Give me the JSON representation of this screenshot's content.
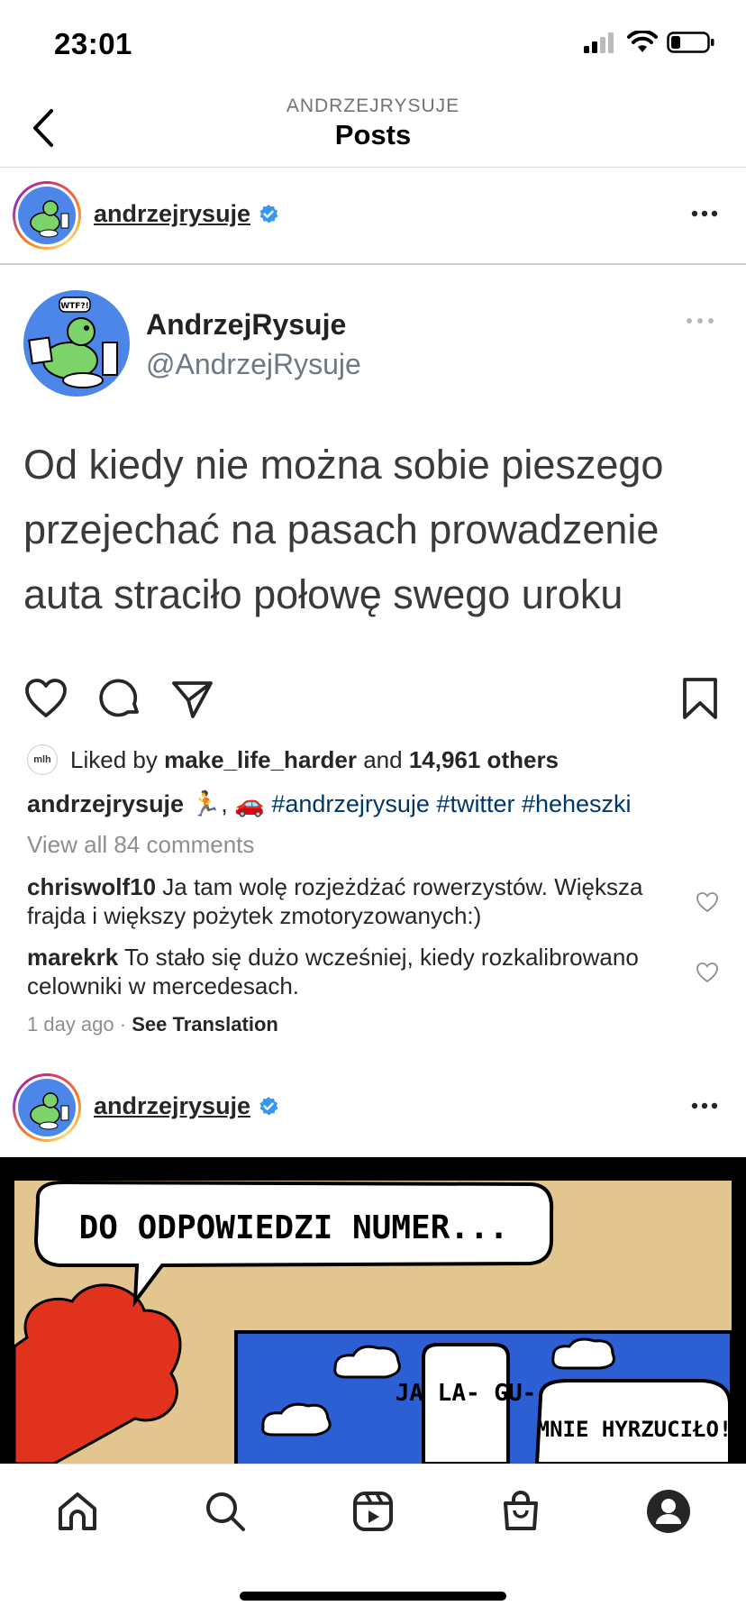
{
  "status": {
    "time": "23:01"
  },
  "header": {
    "subtitle": "ANDRZEJRYSUJE",
    "title": "Posts"
  },
  "post1": {
    "username": "andrzejrysuje",
    "tweet": {
      "name": "AndrzejRysuje",
      "handle": "@AndrzejRysuje",
      "avatar_label": "WTF?!",
      "text": "Od kiedy nie można sobie pieszego przejechać na pasach prowadzenie auta straciło połowę swego uroku"
    },
    "liked": {
      "avatar_text": "mlh",
      "prefix": "Liked by ",
      "user": "make_life_harder",
      "middle": " and ",
      "count": "14,961 others"
    },
    "caption": {
      "user": "andrzejrysuje",
      "emoji": " 🏃, 🚗 ",
      "hashtags": "#andrzejrysuje #twitter #heheszki"
    },
    "view_all": "View all 84 comments",
    "comments": [
      {
        "user": "chriswolf10",
        "text": "Ja tam wolę rozjeżdżać rowerzystów. Większa frajda i większy pożytek zmotoryzowanych:)"
      },
      {
        "user": "marekrk",
        "text": "To stało się dużo wcześniej, kiedy rozkalibrowano celowniki w mercedesach."
      }
    ],
    "time_ago": "1 day ago",
    "separator": "·",
    "translate": "See Translation"
  },
  "post2": {
    "username": "andrzejrysuje",
    "comic": {
      "bubble1": "DO ODPOWIEDZI NUMER...",
      "bubble2": "JA LA- GU-",
      "bubble3": "MNIE HYRZUCIŁO!"
    }
  },
  "colors": {
    "verified": "#3897f0",
    "hashtag": "#00376b",
    "comic_bg": "#e3c58f",
    "comic_sky": "#2d5fd4",
    "comic_red": "#e0321d"
  }
}
